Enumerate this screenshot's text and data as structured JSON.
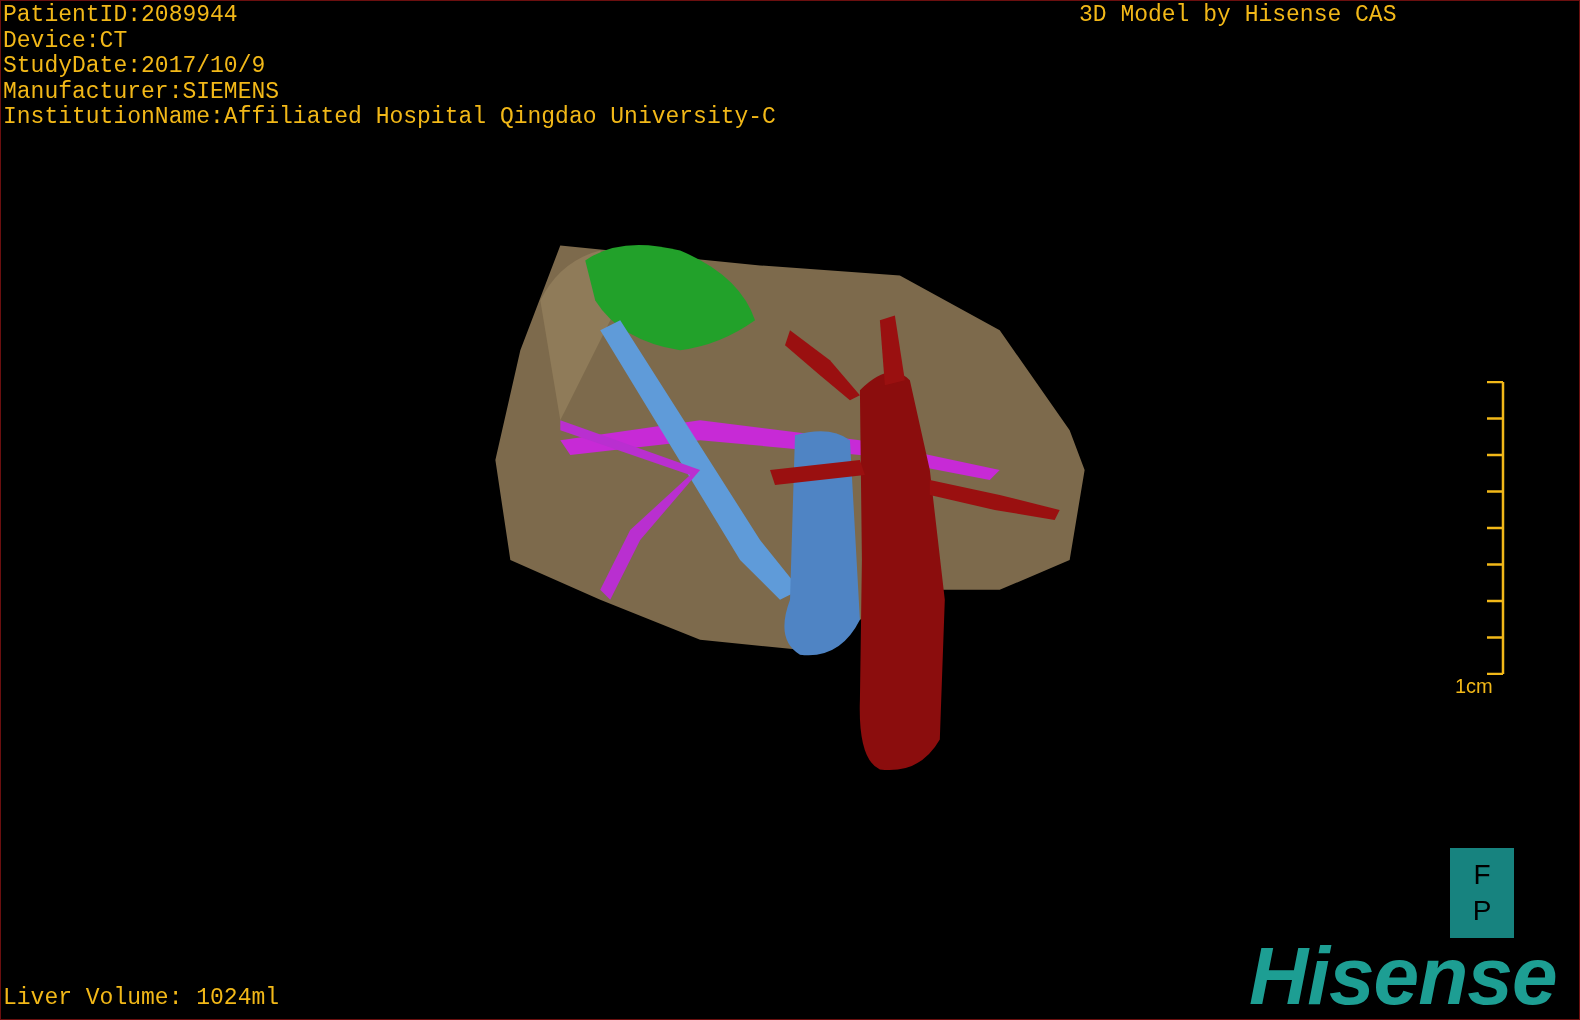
{
  "patient_info": [
    "PatientID:2089944",
    "Device:CT",
    "StudyDate:2017/10/9",
    "Manufacturer:SIEMENS",
    "InstitutionName:Affiliated Hospital Qingdao University-C"
  ],
  "model_credit": "3D Model by Hisense CAS",
  "scale_bar": {
    "label": "1cm"
  },
  "orientation_marker": [
    "F",
    "P"
  ],
  "liver_volume": "Liver Volume: 1024ml",
  "brand_logo": "Hisense"
}
